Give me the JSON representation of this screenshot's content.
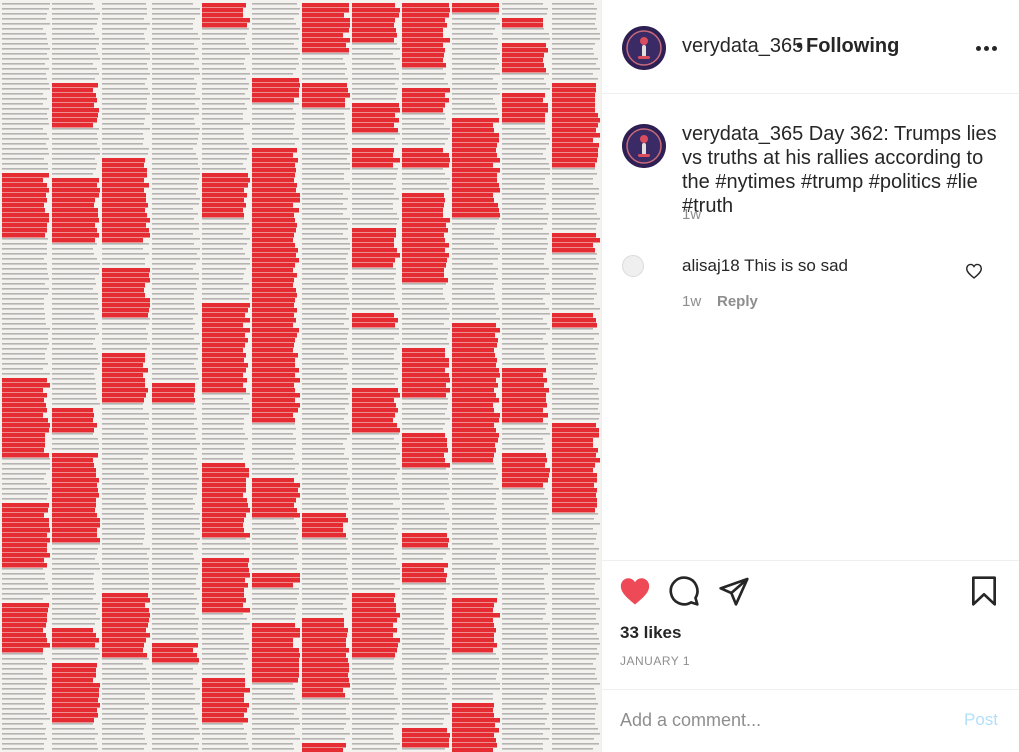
{
  "post": {
    "username": "verydata_365",
    "follow_separator": "•",
    "follow_status": "Following",
    "more_icon": "more-horizontal-icon",
    "image_alt": "Newspaper pages with red highlighted passages"
  },
  "caption": {
    "username": "verydata_365",
    "text": "Day 362: Trumps lies vs truths at his rallies according to the #nytimes #trump #politics #lie #truth",
    "time": "1w"
  },
  "comments": [
    {
      "username": "alisaj18",
      "text": "This is so sad",
      "time": "1w",
      "reply_label": "Reply",
      "like_icon": "heart-outline-icon"
    }
  ],
  "actions": {
    "like_icon": "heart-filled-icon",
    "like_color": "#ed4956",
    "comment_icon": "comment-icon",
    "share_icon": "paper-plane-icon",
    "save_icon": "bookmark-icon",
    "likes_text": "33 likes",
    "date": "JANUARY 1"
  },
  "comment_box": {
    "placeholder": "Add a comment...",
    "post_label": "Post",
    "post_color": "#b2dffc"
  },
  "colors": {
    "highlight": "#e31b23",
    "text_gray": "#8e8e8e"
  }
}
